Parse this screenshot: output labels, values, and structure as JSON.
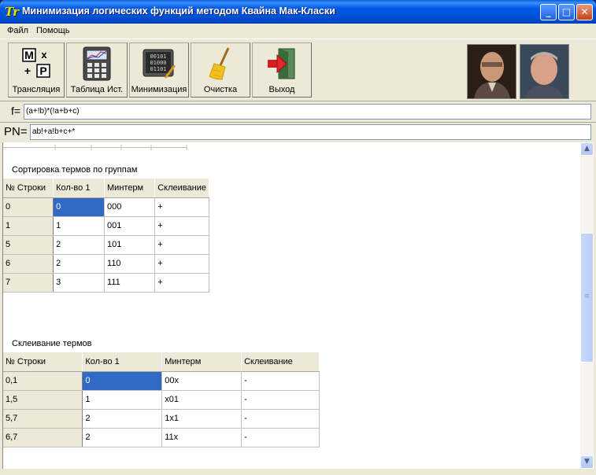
{
  "window": {
    "title": "Минимизация логических функций методом Квайна Мак-Класки",
    "app_icon": "Tr",
    "controls": {
      "minimize": "_",
      "maximize": "□",
      "close": "✕"
    }
  },
  "menu": [
    "Файл",
    "Помощь"
  ],
  "toolbar": {
    "translate_label": "Трансляция",
    "translate_icon_letters": [
      "M",
      "x",
      "+",
      "P"
    ],
    "truth_table_label": "Таблица Ист.",
    "minimize_label": "Минимизация",
    "minimize_icon_bits": [
      "00101",
      "01000",
      "01101"
    ],
    "clear_label": "Очистка",
    "exit_label": "Выход"
  },
  "formula": {
    "label": "f=",
    "value": "(a+!b)*(!a+b+c)"
  },
  "pn": {
    "label": "PN=",
    "value": "ab!+a!b+c+*"
  },
  "groups_table": {
    "title": "Сортировка термов по группам",
    "headers": [
      "№ Строки",
      "Кол-во 1",
      "Минтерм",
      "Склеивание"
    ],
    "rows": [
      [
        "0",
        "0",
        "000",
        "+"
      ],
      [
        "1",
        "1",
        "001",
        "+"
      ],
      [
        "5",
        "2",
        "101",
        "+"
      ],
      [
        "6",
        "2",
        "110",
        "+"
      ],
      [
        "7",
        "3",
        "111",
        "+"
      ]
    ]
  },
  "merge_table": {
    "title": "Склеивание термов",
    "headers": [
      "№ Строки",
      "Кол-во 1",
      "Минтерм",
      "Склеивание"
    ],
    "rows": [
      [
        "0,1",
        "0",
        "00x",
        "-"
      ],
      [
        "1,5",
        "1",
        "x01",
        "-"
      ],
      [
        "5,7",
        "2",
        "1x1",
        "-"
      ],
      [
        "6,7",
        "2",
        "11x",
        "-"
      ]
    ]
  },
  "colors": {
    "titlebar": "#0058e6",
    "selection": "#316ac5",
    "window_bg": "#ece9d8"
  }
}
